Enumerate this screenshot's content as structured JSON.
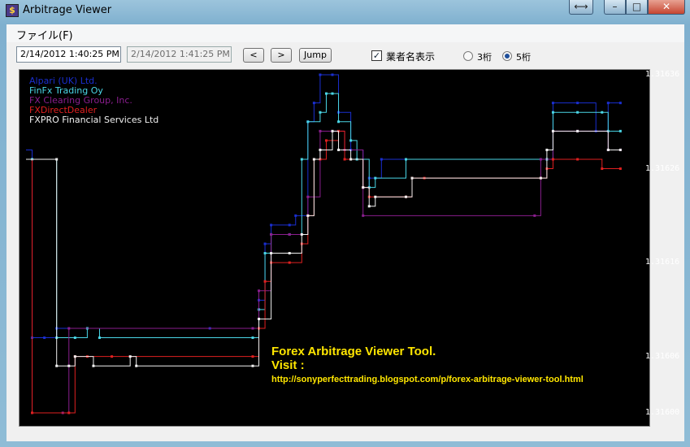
{
  "window": {
    "title": "Arbitrage Viewer",
    "swap_glyph": "⟷",
    "min_glyph": "–",
    "max_glyph": "□",
    "close_glyph": "✕",
    "app_icon_glyph": "$"
  },
  "menu": {
    "file": "ファイル(F)"
  },
  "toolbar": {
    "start_time": "2/14/2012 1:40:25 PM",
    "end_time": "2/14/2012 1:41:25 PM",
    "prev_label": "<",
    "next_label": ">",
    "jump_label": "Jump",
    "show_names_label": "業者名表示",
    "show_names_checked": true,
    "digits3_label": "3桁",
    "digits5_label": "5桁",
    "digits_selected": "5桁"
  },
  "chart_data": {
    "type": "line",
    "step": true,
    "ylim": [
      1.316,
      1.31636
    ],
    "y_ticks": [
      "1.31636",
      "1.31626",
      "1.31616",
      "1.31606",
      "1.31600"
    ],
    "legend_placement": "top-left",
    "x_index_max": 100,
    "series": [
      {
        "name": "Alpari (UK) Ltd.",
        "color": "#1a2fd0",
        "points": [
          [
            0,
            1.31628
          ],
          [
            1,
            1.31608
          ],
          [
            3,
            1.31608
          ],
          [
            5,
            1.31609
          ],
          [
            30,
            1.31609
          ],
          [
            37,
            1.31609
          ],
          [
            38,
            1.31612
          ],
          [
            39,
            1.31618
          ],
          [
            40,
            1.3162
          ],
          [
            43,
            1.3162
          ],
          [
            44,
            1.31621
          ],
          [
            46,
            1.31631
          ],
          [
            47,
            1.31633
          ],
          [
            48,
            1.31636
          ],
          [
            50,
            1.31636
          ],
          [
            51,
            1.31632
          ],
          [
            53,
            1.31628
          ],
          [
            55,
            1.31624
          ],
          [
            56,
            1.31625
          ],
          [
            58,
            1.31627
          ],
          [
            85,
            1.31627
          ],
          [
            86,
            1.31633
          ],
          [
            90,
            1.31633
          ],
          [
            93,
            1.3163
          ],
          [
            95,
            1.31633
          ],
          [
            97,
            1.31633
          ]
        ]
      },
      {
        "name": "FinFx Trading Oy",
        "color": "#4ad6e6",
        "points": [
          [
            0,
            1.31627
          ],
          [
            1,
            1.31627
          ],
          [
            5,
            1.31608
          ],
          [
            8,
            1.31608
          ],
          [
            10,
            1.31609
          ],
          [
            12,
            1.31608
          ],
          [
            37,
            1.31608
          ],
          [
            38,
            1.31611
          ],
          [
            39,
            1.31617
          ],
          [
            40,
            1.31619
          ],
          [
            43,
            1.31619
          ],
          [
            45,
            1.31627
          ],
          [
            46,
            1.31631
          ],
          [
            48,
            1.31632
          ],
          [
            49,
            1.31634
          ],
          [
            50,
            1.31634
          ],
          [
            51,
            1.31631
          ],
          [
            53,
            1.31629
          ],
          [
            54,
            1.31627
          ],
          [
            56,
            1.31624
          ],
          [
            57,
            1.31625
          ],
          [
            62,
            1.31627
          ],
          [
            85,
            1.31627
          ],
          [
            86,
            1.31632
          ],
          [
            90,
            1.31632
          ],
          [
            94,
            1.31632
          ],
          [
            95,
            1.3163
          ],
          [
            97,
            1.3163
          ]
        ]
      },
      {
        "name": "FX Clearing Group, Inc.",
        "color": "#8a1e8e",
        "points": [
          [
            0,
            1.31627
          ],
          [
            1,
            1.316
          ],
          [
            6,
            1.316
          ],
          [
            7,
            1.31609
          ],
          [
            37,
            1.31609
          ],
          [
            38,
            1.31613
          ],
          [
            40,
            1.31619
          ],
          [
            43,
            1.31619
          ],
          [
            46,
            1.31623
          ],
          [
            48,
            1.3163
          ],
          [
            50,
            1.3163
          ],
          [
            52,
            1.31628
          ],
          [
            55,
            1.31621
          ],
          [
            83,
            1.31621
          ],
          [
            84,
            1.31627
          ],
          [
            86,
            1.3163
          ],
          [
            90,
            1.3163
          ],
          [
            95,
            1.31628
          ],
          [
            97,
            1.31628
          ]
        ]
      },
      {
        "name": "FXDirectDealer",
        "color": "#e02020",
        "points": [
          [
            0,
            1.31627
          ],
          [
            1,
            1.316
          ],
          [
            7,
            1.316
          ],
          [
            8,
            1.31606
          ],
          [
            10,
            1.31606
          ],
          [
            14,
            1.31606
          ],
          [
            37,
            1.31606
          ],
          [
            38,
            1.31609
          ],
          [
            39,
            1.31614
          ],
          [
            40,
            1.31616
          ],
          [
            43,
            1.31616
          ],
          [
            45,
            1.31618
          ],
          [
            46,
            1.31621
          ],
          [
            47,
            1.31627
          ],
          [
            48,
            1.31627
          ],
          [
            49,
            1.31629
          ],
          [
            51,
            1.3163
          ],
          [
            52,
            1.31627
          ],
          [
            53,
            1.31627
          ],
          [
            55,
            1.31624
          ],
          [
            56,
            1.31623
          ],
          [
            62,
            1.31623
          ],
          [
            63,
            1.31625
          ],
          [
            65,
            1.31625
          ],
          [
            84,
            1.31625
          ],
          [
            85,
            1.31626
          ],
          [
            86,
            1.31627
          ],
          [
            90,
            1.31627
          ],
          [
            94,
            1.31626
          ],
          [
            97,
            1.31626
          ]
        ]
      },
      {
        "name": "FXPRO Financial Services Ltd",
        "color": "#f0f0f0",
        "points": [
          [
            0,
            1.31627
          ],
          [
            5,
            1.31627
          ],
          [
            5,
            1.31605
          ],
          [
            7,
            1.31605
          ],
          [
            8,
            1.31606
          ],
          [
            11,
            1.31605
          ],
          [
            17,
            1.31606
          ],
          [
            18,
            1.31605
          ],
          [
            37,
            1.31605
          ],
          [
            38,
            1.3161
          ],
          [
            40,
            1.31617
          ],
          [
            43,
            1.31617
          ],
          [
            45,
            1.31619
          ],
          [
            46,
            1.31621
          ],
          [
            47,
            1.31627
          ],
          [
            48,
            1.31628
          ],
          [
            50,
            1.3163
          ],
          [
            51,
            1.31628
          ],
          [
            53,
            1.31627
          ],
          [
            55,
            1.31624
          ],
          [
            56,
            1.31622
          ],
          [
            57,
            1.31623
          ],
          [
            62,
            1.31623
          ],
          [
            63,
            1.31625
          ],
          [
            84,
            1.31625
          ],
          [
            85,
            1.31628
          ],
          [
            86,
            1.3163
          ],
          [
            90,
            1.3163
          ],
          [
            95,
            1.31628
          ],
          [
            97,
            1.31628
          ]
        ]
      }
    ]
  },
  "banner": {
    "line1": "Forex Arbitrage Viewer Tool.",
    "line2": "Visit :",
    "line3": "http://sonyperfecttrading.blogspot.com/p/forex-arbitrage-viewer-tool.html"
  }
}
